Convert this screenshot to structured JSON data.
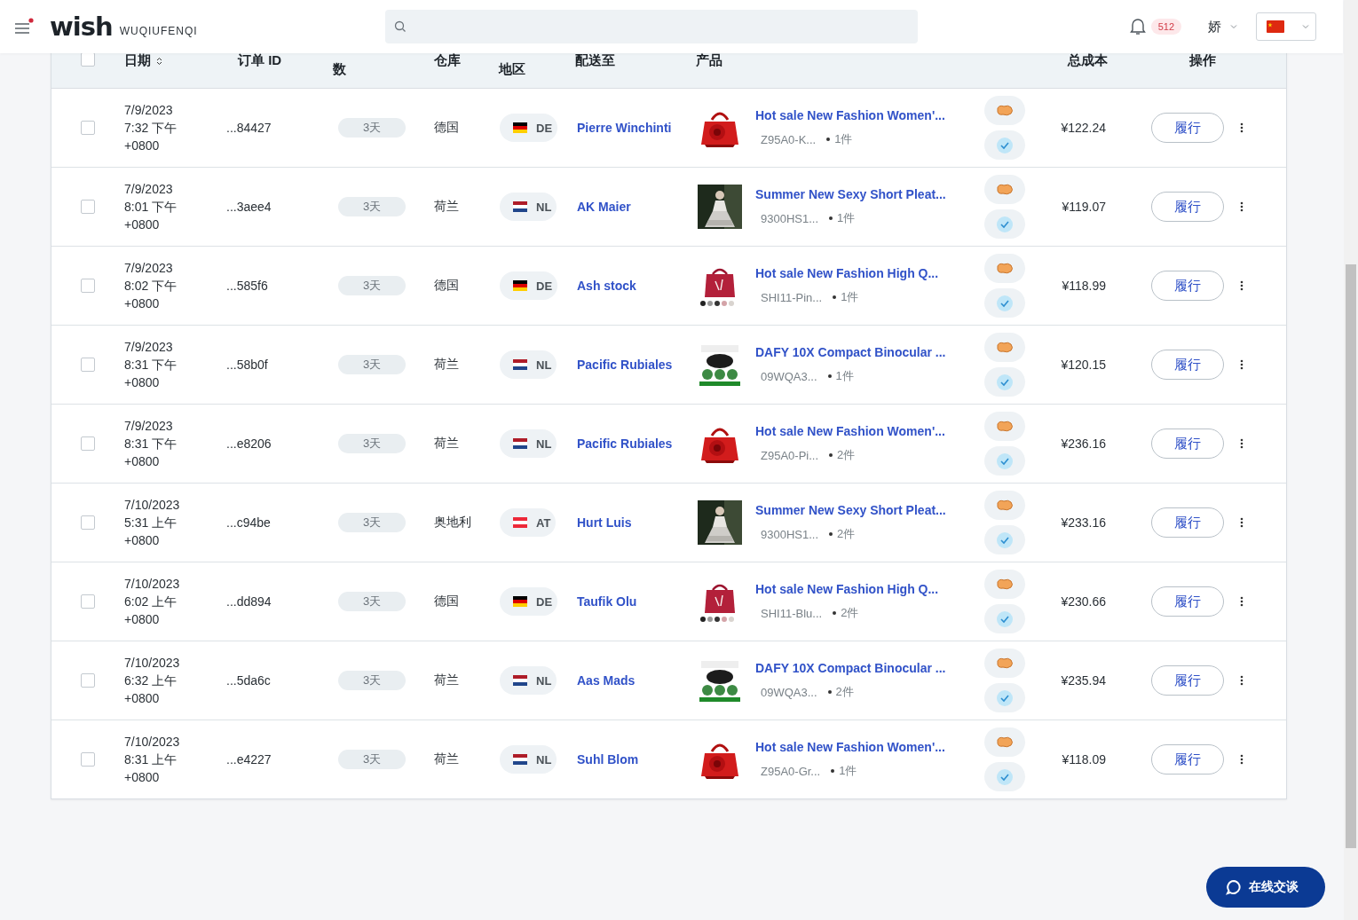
{
  "topbar": {
    "logo": "wish",
    "store": "WUQIUFENQI",
    "notifications": "512",
    "user": "娇"
  },
  "table": {
    "select_all": {
      "checked": false
    },
    "columns": [
      {
        "label": "日期",
        "sortable": true
      },
      {
        "label": "订单 ID",
        "sortable": false
      },
      {
        "label": "数",
        "sortable": false
      },
      {
        "label": "仓库",
        "sortable": false
      },
      {
        "label": "地区",
        "sortable": false
      },
      {
        "label": "配送至",
        "sortable": false
      },
      {
        "label": "产品",
        "sortable": false
      },
      {
        "label": "总成本",
        "sortable": false
      },
      {
        "label": "操作",
        "sortable": false
      }
    ],
    "rows": [
      {
        "checked": false,
        "date": "7/9/2023",
        "time": "7:32 下午",
        "tz": "+0800",
        "order_id": "...84427",
        "days": "3天",
        "warehouse": "德国",
        "kind": "de",
        "country": "DE",
        "ship_to": "Pierre Winchinti",
        "product": "Hot sale New Fashion Women'...",
        "sku": "Z95A0-K...",
        "qty": "1件",
        "cost": "¥122.24",
        "action": "履行"
      },
      {
        "checked": false,
        "date": "7/9/2023",
        "time": "8:01 下午",
        "tz": "+0800",
        "order_id": "...3aee4",
        "days": "3天",
        "warehouse": "荷兰",
        "kind": "nl",
        "country": "NL",
        "ship_to": "AK Maier",
        "product": "Summer New Sexy Short Pleat...",
        "sku": "9300HS1...",
        "qty": "1件",
        "cost": "¥119.07",
        "action": "履行"
      },
      {
        "checked": false,
        "date": "7/9/2023",
        "time": "8:02 下午",
        "tz": "+0800",
        "order_id": "...585f6",
        "days": "3天",
        "warehouse": "德国",
        "kind": "de",
        "country": "DE",
        "ship_to": "Ash stock",
        "product": "Hot sale New Fashion High Q...",
        "sku": "SHI11-Pin...",
        "qty": "1件",
        "cost": "¥118.99",
        "action": "履行"
      },
      {
        "checked": false,
        "date": "7/9/2023",
        "time": "8:31 下午",
        "tz": "+0800",
        "order_id": "...58b0f",
        "days": "3天",
        "warehouse": "荷兰",
        "kind": "nl",
        "country": "NL",
        "ship_to": "Pacific Rubiales",
        "product": "DAFY 10X Compact Binocular ...",
        "sku": "09WQA3...",
        "qty": "1件",
        "cost": "¥120.15",
        "action": "履行"
      },
      {
        "checked": false,
        "date": "7/9/2023",
        "time": "8:31 下午",
        "tz": "+0800",
        "order_id": "...e8206",
        "days": "3天",
        "warehouse": "荷兰",
        "kind": "nl",
        "country": "NL",
        "ship_to": "Pacific Rubiales",
        "product": "Hot sale New Fashion Women'...",
        "sku": "Z95A0-Pi...",
        "qty": "2件",
        "cost": "¥236.16",
        "action": "履行"
      },
      {
        "checked": false,
        "date": "7/10/2023",
        "time": "5:31 上午",
        "tz": "+0800",
        "order_id": "...c94be",
        "days": "3天",
        "warehouse": "奥地利",
        "kind": "at",
        "country": "AT",
        "ship_to": "Hurt Luis",
        "product": "Summer New Sexy Short Pleat...",
        "sku": "9300HS1...",
        "qty": "2件",
        "cost": "¥233.16",
        "action": "履行"
      },
      {
        "checked": false,
        "date": "7/10/2023",
        "time": "6:02 上午",
        "tz": "+0800",
        "order_id": "...dd894",
        "days": "3天",
        "warehouse": "德国",
        "kind": "de",
        "country": "DE",
        "ship_to": "Taufik Olu",
        "product": "Hot sale New Fashion High Q...",
        "sku": "SHI11-Blu...",
        "qty": "2件",
        "cost": "¥230.66",
        "action": "履行"
      },
      {
        "checked": false,
        "date": "7/10/2023",
        "time": "6:32 上午",
        "tz": "+0800",
        "order_id": "...5da6c",
        "days": "3天",
        "warehouse": "荷兰",
        "kind": "nl",
        "country": "NL",
        "ship_to": "Aas Mads",
        "product": "DAFY 10X Compact Binocular ...",
        "sku": "09WQA3...",
        "qty": "2件",
        "cost": "¥235.94",
        "action": "履行"
      },
      {
        "checked": false,
        "date": "7/10/2023",
        "time": "8:31 上午",
        "tz": "+0800",
        "order_id": "...e4227",
        "days": "3天",
        "warehouse": "荷兰",
        "kind": "nl",
        "country": "NL",
        "ship_to": "Suhl Blom",
        "product": "Hot sale New Fashion Women'...",
        "sku": "Z95A0-Gr...",
        "qty": "1件",
        "cost": "¥118.09",
        "action": "履行"
      }
    ]
  },
  "chat_button": "在线交谈"
}
